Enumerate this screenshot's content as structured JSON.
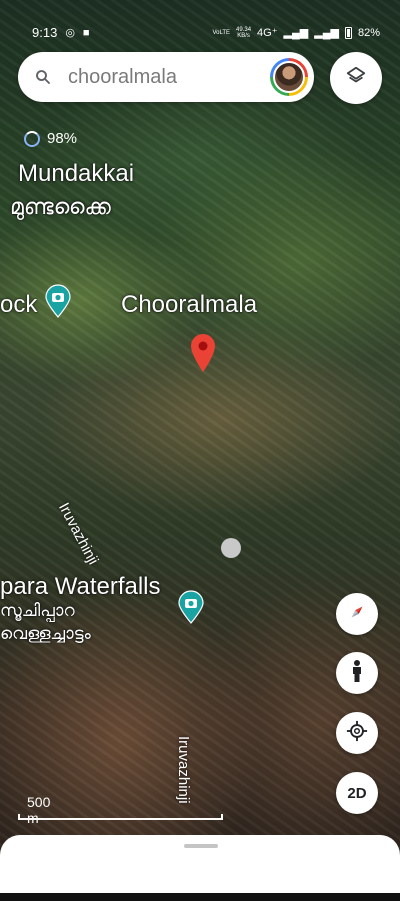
{
  "status_bar": {
    "time": "9:13",
    "speed_top": "49.34",
    "speed_unit": "KB/s",
    "volte": "VoLTE",
    "network": "4G⁺",
    "battery": "82%"
  },
  "search": {
    "query": "chooralmala"
  },
  "map": {
    "loading_percent": "98%",
    "labels": {
      "mundakkai": "Mundakkai",
      "mundakkai_ml": "മുണ്ടക്കൈ",
      "chooralmala": "Chooralmala",
      "rock_partial": "ock",
      "waterfalls_partial": "para Waterfalls",
      "waterfalls_ml_1": "സൂചിപ്പാറ",
      "waterfalls_ml_2": "വെള്ളച്ചാട്ടം",
      "road_1": "Iruvazhinji",
      "road_2": "Iruvazhinji"
    },
    "scale_label": "500 m",
    "mode_button": "2D"
  },
  "colors": {
    "pin_red": "#ea4335",
    "camera_teal": "#1aa3a3",
    "accent_blue": "#8ab4f8"
  },
  "icons": [
    "search-icon",
    "layers-icon",
    "compass-icon",
    "pegman-icon",
    "my-location-icon",
    "camera-icon",
    "location-pin-icon"
  ]
}
